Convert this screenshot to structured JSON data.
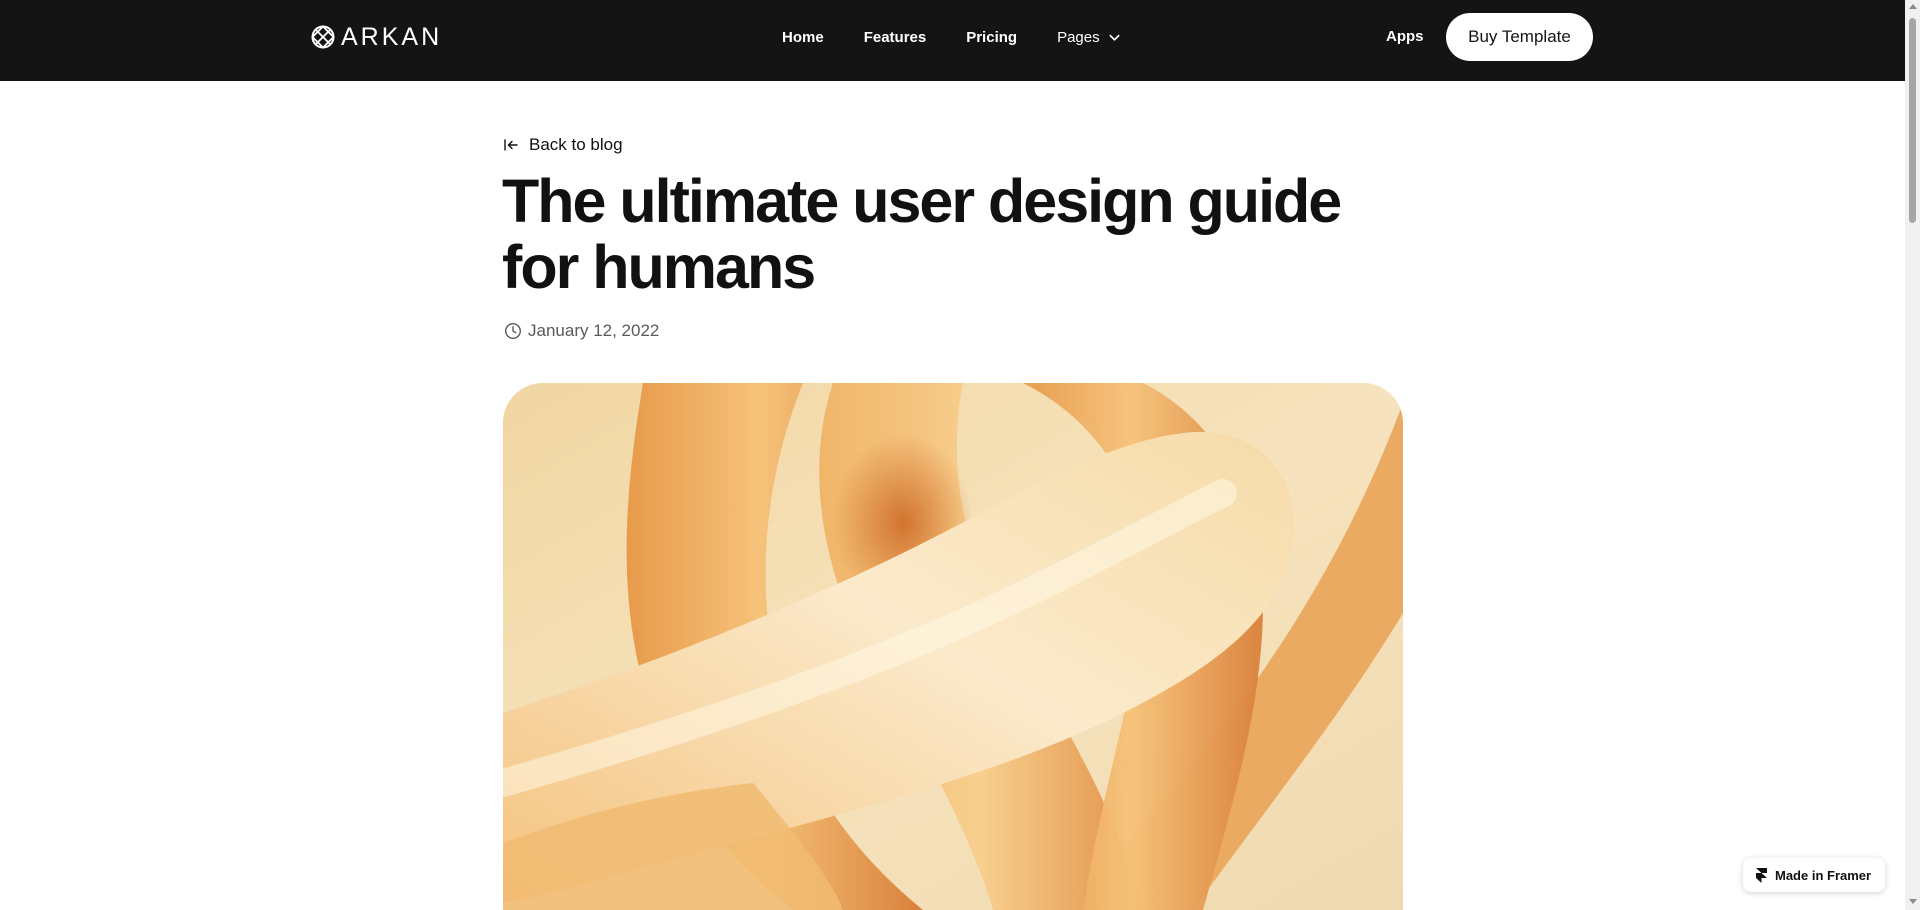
{
  "brand": {
    "name": "ARKAN",
    "logo_icon": "arkan-logo-icon"
  },
  "nav": {
    "links": [
      {
        "label": "Home"
      },
      {
        "label": "Features"
      },
      {
        "label": "Pricing"
      },
      {
        "label": "Pages",
        "icon": "chevron-down-icon"
      }
    ],
    "apps_label": "Apps",
    "cta_label": "Buy Template"
  },
  "article": {
    "back_label": "Back to blog",
    "back_icon": "arrow-left-to-line-icon",
    "title": "The ultimate user design guide for humans",
    "date": "January 12, 2022",
    "date_icon": "clock-icon",
    "hero_image": "orange-abstract-tubes-image"
  },
  "badge": {
    "label": "Made in Framer",
    "icon": "framer-icon"
  },
  "colors": {
    "nav_bg": "#141414",
    "text": "#111111",
    "muted": "#5a5a5a",
    "hero_light": "#f7ebc8",
    "hero_mid": "#f0b468",
    "hero_dark": "#d0702a"
  }
}
